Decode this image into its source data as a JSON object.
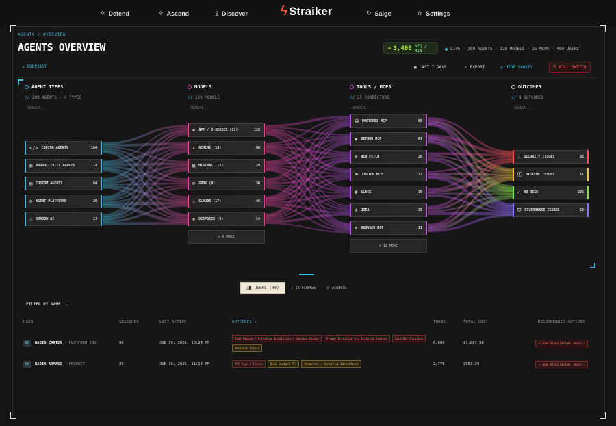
{
  "nav": {
    "items": [
      {
        "label": "Defend",
        "icon": "sparkle-icon"
      },
      {
        "label": "Ascend",
        "icon": "sparkle-icon"
      },
      {
        "label": "Discover",
        "icon": "download-icon"
      },
      {
        "label": "Saige",
        "icon": "refresh-icon"
      },
      {
        "label": "Settings",
        "icon": "star-icon"
      }
    ],
    "brand": "Straiker"
  },
  "header": {
    "breadcrumb": "AGENTS / OVERVIEW",
    "title": "AGENTS OVERVIEW",
    "req_value": "3,400",
    "req_unit": "REQ / MIN",
    "live_stats": "LIVE · 209 AGENTS · 128 MODELS · 25 MCPS · 400 USERS",
    "endpoint_label": "ENDPOINT"
  },
  "toolbar": {
    "range_label": "LAST 7 DAYS",
    "export_label": "EXPORT",
    "hide_label": "HIDE SANKEY",
    "kill_label": "KILL SWITCH"
  },
  "columns": [
    {
      "title": "AGENT TYPES",
      "sub": "209 AGENTS · 4 TYPES",
      "search": "SEARCH...",
      "color": "#3fb8d8"
    },
    {
      "title": "MODELS",
      "sub": "129 MODELS",
      "search": "SEARCH...",
      "color": "#e8459a"
    },
    {
      "title": "TOOLS / MCPS",
      "sub": "25 CONNECTORS",
      "search": "SEARCH...",
      "color": "#c050e0"
    },
    {
      "title": "OUTCOMES",
      "sub": "4 OUTCOMES",
      "search": "SEARCH...",
      "color": "#d8d8d8"
    }
  ],
  "agents": [
    {
      "label": "CODING AGENTS",
      "count": "164",
      "icon": "code-icon"
    },
    {
      "label": "PRODUCTIVITY AGENTS",
      "count": "114",
      "icon": "briefcase-icon"
    },
    {
      "label": "CUSTOM AGENTS",
      "count": "84",
      "icon": "window-icon"
    },
    {
      "label": "AGENT PLATFORMS",
      "count": "29",
      "icon": "gear-icon"
    },
    {
      "label": "SHADOW AI",
      "count": "17",
      "icon": "warning-icon"
    }
  ],
  "models": [
    {
      "label": "GPT / O-SERIES (17)",
      "count": "126",
      "icon": "openai-icon"
    },
    {
      "label": "GEMINI (14)",
      "count": "68",
      "icon": "gemini-icon"
    },
    {
      "label": "MISTRAL (12)",
      "count": "29",
      "icon": "mistral-icon"
    },
    {
      "label": "GROK (9)",
      "count": "30",
      "icon": "grok-icon"
    },
    {
      "label": "CLAUDE (17)",
      "count": "46",
      "icon": "claude-icon"
    },
    {
      "label": "DEEPSEEK (9)",
      "count": "24",
      "icon": "deepseek-icon"
    }
  ],
  "models_more": "+ 6 MORE",
  "tools": [
    {
      "label": "POSTGRES MCP",
      "count": "85",
      "icon": "database-icon"
    },
    {
      "label": "GITHUB MCP",
      "count": "67",
      "icon": "github-icon"
    },
    {
      "label": "WEB FETCH",
      "count": "26",
      "icon": "globe-icon"
    },
    {
      "label": "CUSTOM MCP",
      "count": "22",
      "icon": "link-icon"
    },
    {
      "label": "SLACK",
      "count": "39",
      "icon": "slack-icon"
    },
    {
      "label": "JIRA",
      "count": "36",
      "icon": "jira-icon"
    },
    {
      "label": "BROWSER MCP",
      "count": "11",
      "icon": "globe-icon"
    }
  ],
  "tools_more": "+ 18 MORE",
  "outcomes": [
    {
      "label": "SECURITY ISSUES",
      "count": "82",
      "icon": "warning-icon",
      "color": "#ff5050"
    },
    {
      "label": "HYGIENE ISSUES",
      "count": "71",
      "icon": "info-icon",
      "color": "#f0c040"
    },
    {
      "label": "NO RISK",
      "count": "225",
      "icon": "check-icon",
      "color": "#80e040"
    },
    {
      "label": "GOVERNANCE ISSUES",
      "count": "22",
      "icon": "shield-icon",
      "color": "#9070ff"
    }
  ],
  "tabs": [
    {
      "label": "USERS (44)",
      "icon": "users-icon"
    },
    {
      "label": "OUTCOMES",
      "icon": "warning-icon"
    },
    {
      "label": "AGENTS",
      "icon": "target-icon"
    }
  ],
  "table": {
    "filter_placeholder": "FILTER BY NAME...",
    "headers": [
      "USER",
      "SESSIONS",
      "LAST ACTIVE",
      "OUTCOMES ↓",
      "TURNS",
      "TOTAL COST",
      "RECOMMENDED ACTIONS"
    ],
    "rows": [
      {
        "initials": "NC",
        "name": "NADIA CARTER",
        "role": "· PLATFORM ENG",
        "sessions": "98",
        "last_active": "JUN 19, 2026, 10:24 PM",
        "tags": [
          {
            "text": "Tool Misuse / Privilege Escalation / Sandbox Escape",
            "tone": "red"
          },
          {
            "text": "Prompt Injection via Injected Content",
            "tone": "red"
          },
          {
            "text": "Data Exfiltration",
            "tone": "red"
          },
          {
            "text": "Personal Topics",
            "tone": "amber"
          }
        ],
        "turns": "6,600",
        "cost": "$1,867.98",
        "action": "+ 2608 RISKS DEFEND: BLOCK →"
      },
      {
        "initials": "NA",
        "name": "NADIA AHMADI",
        "role": "· PRODUCT",
        "sessions": "39",
        "last_active": "JUN 19, 2026, 11:14 PM",
        "tags": [
          {
            "text": "API Keys / Tokens",
            "tone": "red"
          },
          {
            "text": "Bulk Contact PII",
            "tone": "amber"
          },
          {
            "text": "Biometric / Sensitive Identifiers",
            "tone": "amber"
          }
        ],
        "turns": "2,776",
        "cost": "$963.39",
        "action": "+ 1096 RISKS DEFEND: BLOCK →"
      }
    ]
  }
}
